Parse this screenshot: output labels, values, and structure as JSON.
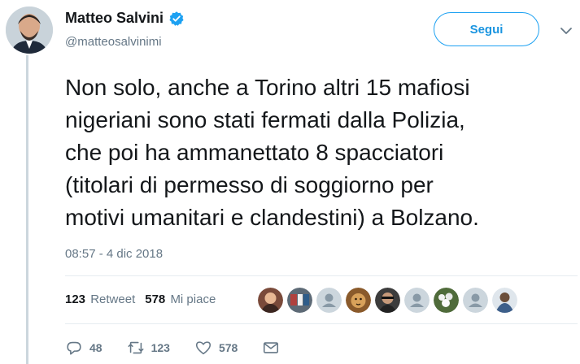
{
  "author": {
    "display_name": "Matteo Salvini",
    "handle": "@matteosalvinimi",
    "verified": true
  },
  "follow_button": "Segui",
  "tweet": {
    "lines": [
      "Non solo, anche a Torino altri 15 mafiosi",
      "nigeriani sono stati fermati dalla Polizia,",
      "che poi ha ammanettato 8 spacciatori",
      "(titolari di permesso di soggiorno per",
      "motivi umanitari e clandestini) a Bolzano."
    ],
    "timestamp": "08:57 - 4 dic 2018"
  },
  "stats": {
    "retweets_count": "123",
    "retweets_label": "Retweet",
    "likes_count": "578",
    "likes_label": "Mi piace"
  },
  "actions": {
    "replies": "48",
    "retweets": "123",
    "likes": "578"
  },
  "colors": {
    "accent": "#1da1f2",
    "muted": "#657786",
    "divider": "#e6ecf0"
  }
}
